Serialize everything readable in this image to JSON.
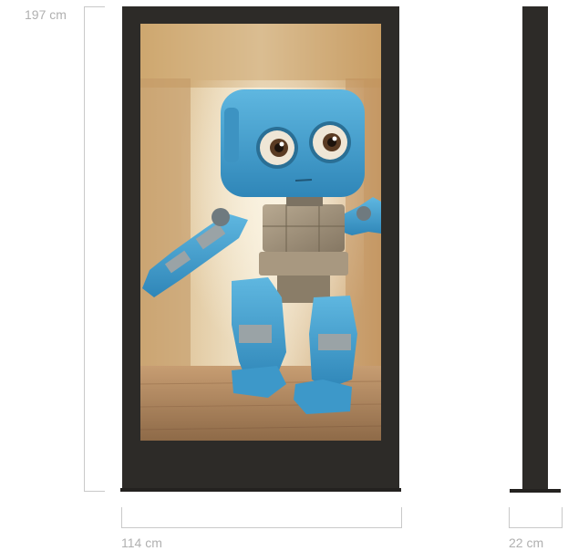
{
  "dimensions": {
    "height_label": "197 cm",
    "width_label": "114 cm",
    "depth_label": "22 cm"
  },
  "display": {
    "screen_content": "blue-robot-illustration",
    "frame_color": "#2d2b28"
  }
}
